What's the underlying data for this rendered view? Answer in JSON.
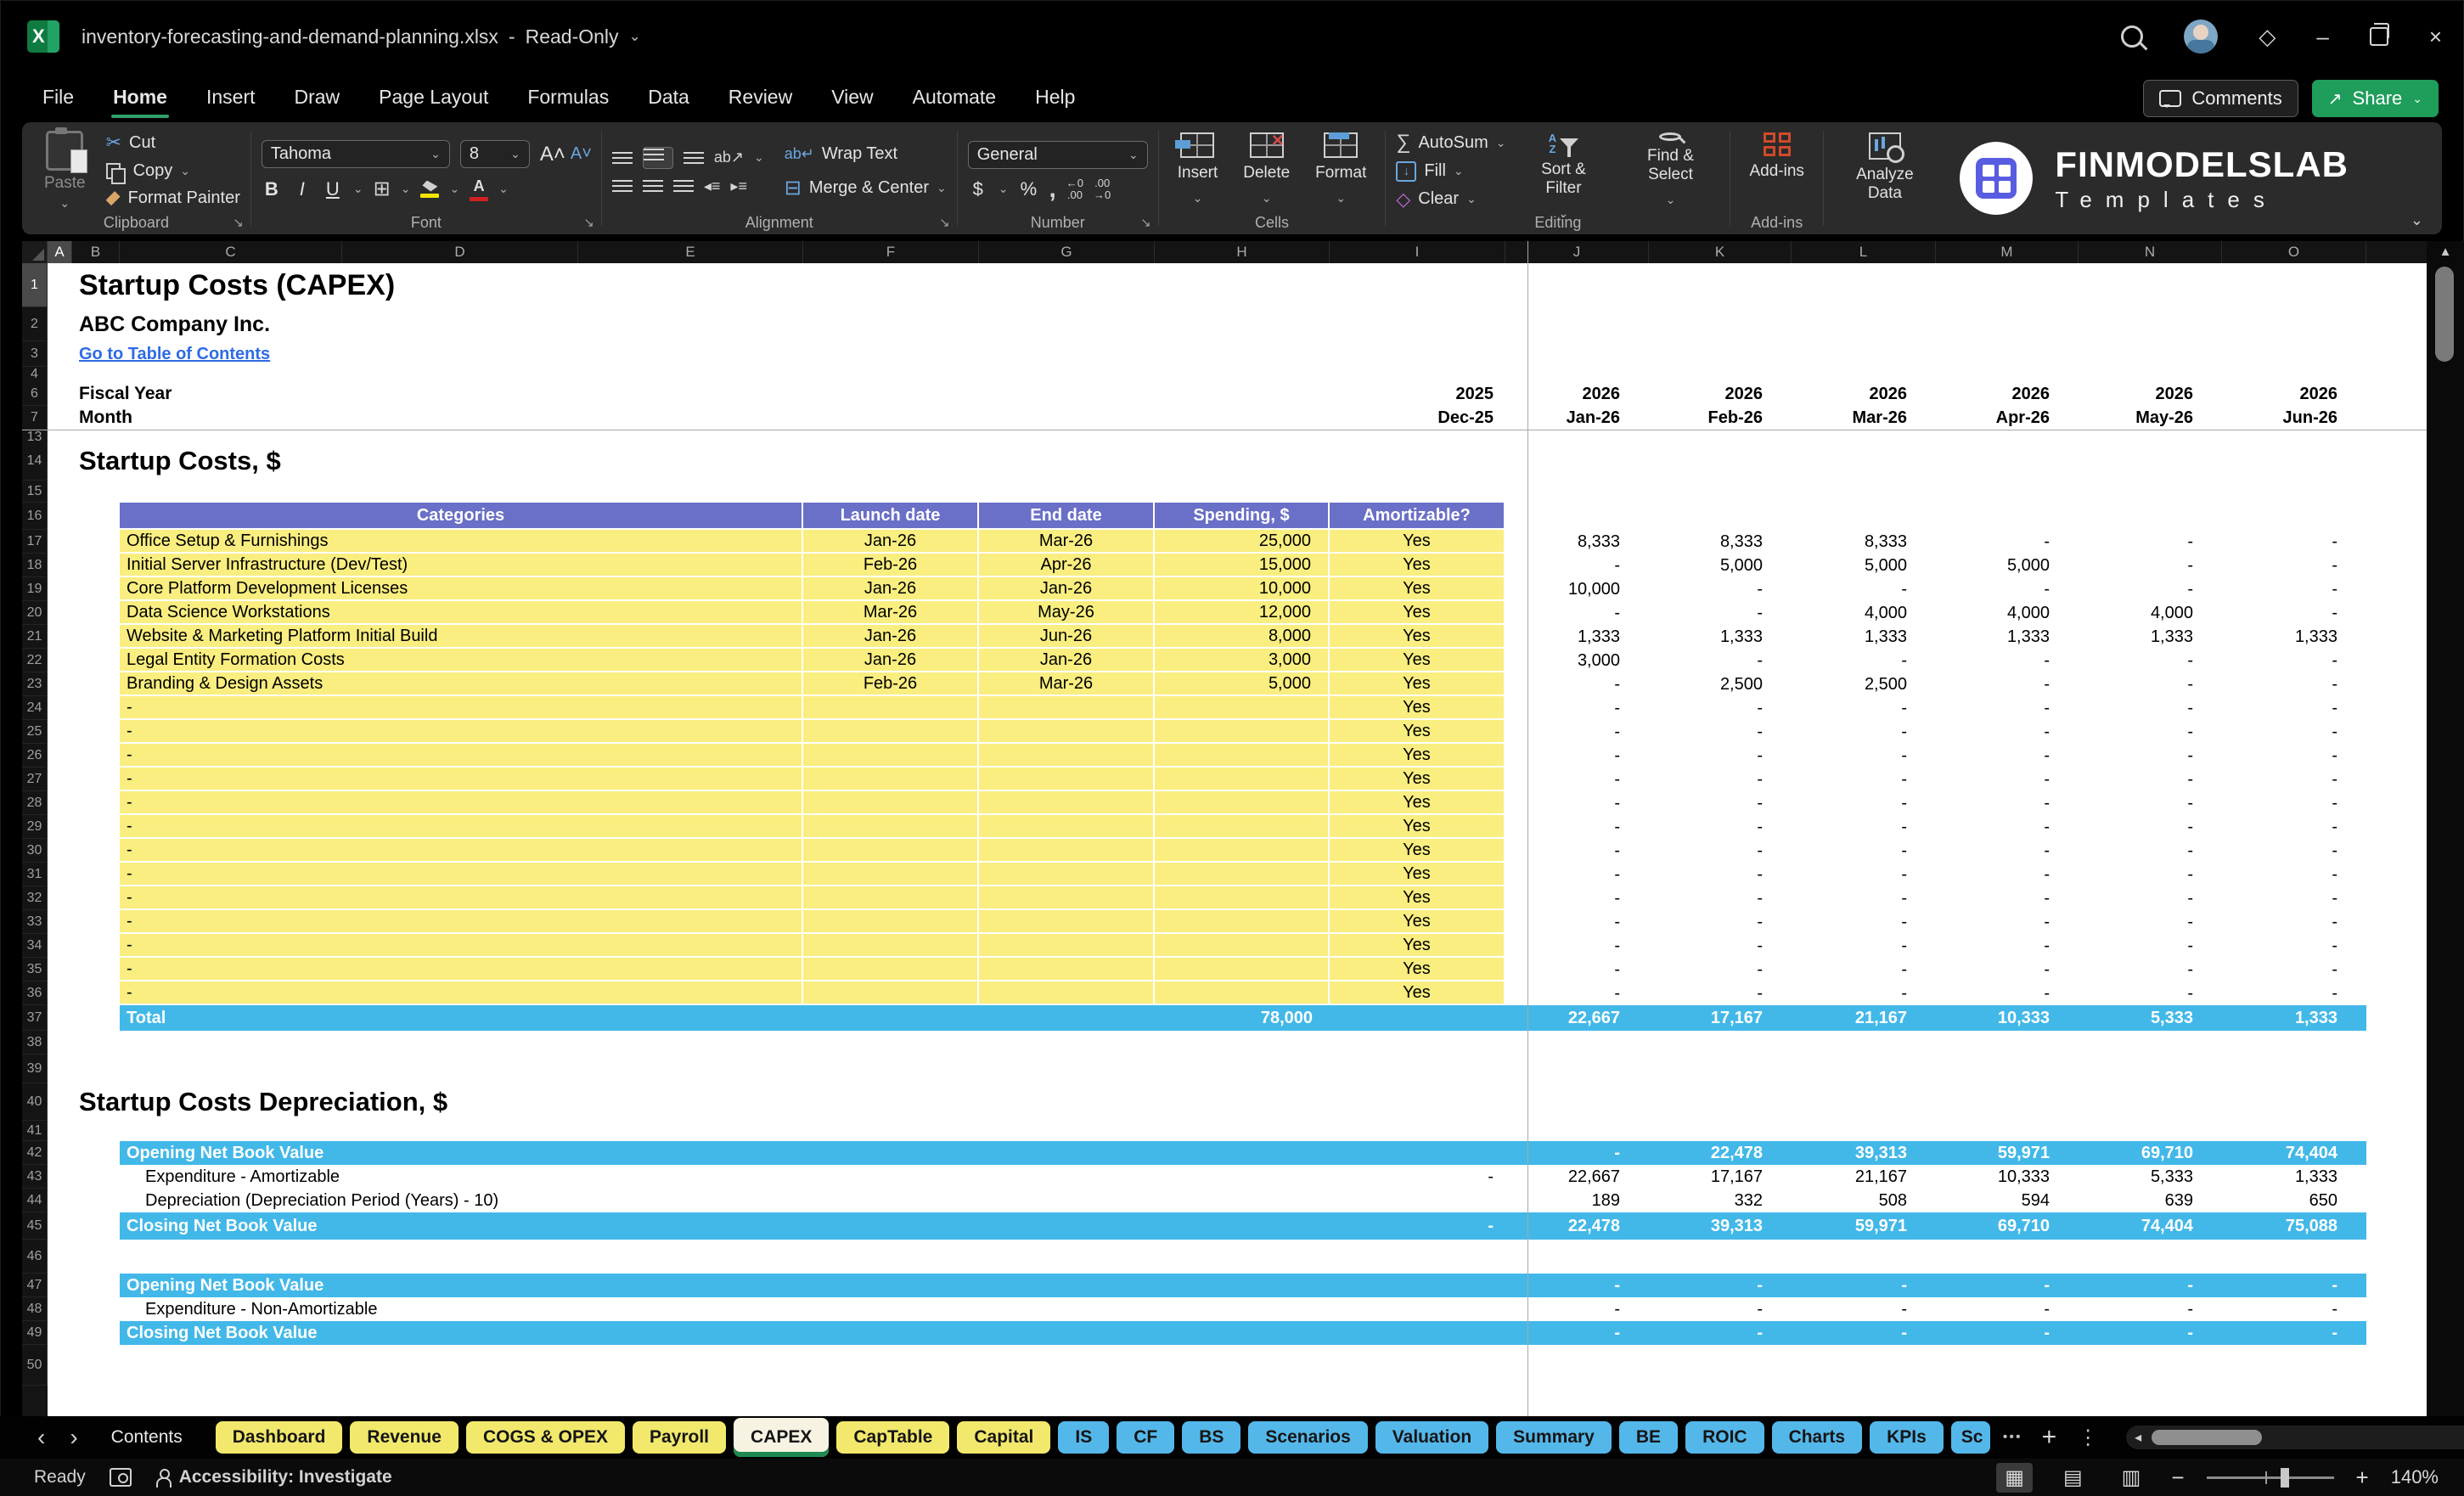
{
  "titlebar": {
    "filename": "inventory-forecasting-and-demand-planning.xlsx",
    "separator": "-",
    "mode": "Read-Only"
  },
  "menubar": {
    "items": [
      "File",
      "Home",
      "Insert",
      "Draw",
      "Page Layout",
      "Formulas",
      "Data",
      "Review",
      "View",
      "Automate",
      "Help"
    ],
    "active": "Home"
  },
  "actions": {
    "comments": "Comments",
    "share": "Share"
  },
  "ribbon": {
    "clipboard": {
      "group_label": "Clipboard",
      "paste": "Paste",
      "cut": "Cut",
      "copy": "Copy",
      "format_painter": "Format Painter"
    },
    "font": {
      "group_label": "Font",
      "font_name": "Tahoma",
      "font_size": "8",
      "bold": "B",
      "italic": "I",
      "underline": "U"
    },
    "alignment": {
      "group_label": "Alignment",
      "wrap_text": "Wrap Text",
      "merge_center": "Merge & Center"
    },
    "number": {
      "group_label": "Number",
      "format": "General",
      "currency": "$",
      "percent": "%"
    },
    "cells": {
      "group_label": "Cells",
      "insert": "Insert",
      "delete": "Delete",
      "format": "Format"
    },
    "editing": {
      "group_label": "Editing",
      "autosum": "AutoSum",
      "fill": "Fill",
      "clear": "Clear",
      "sort_filter": "Sort & Filter",
      "find_select": "Find & Select"
    },
    "addins": {
      "group_label": "Add-ins",
      "addins": "Add-ins",
      "analyze_data": "Analyze Data"
    }
  },
  "brand": {
    "name": "FINMODELSLAB",
    "subtitle": "Templates"
  },
  "colors": {
    "table_header_purple": "#6A6FC7",
    "row_yellow": "#F9EE7F",
    "band_blue": "#42B8E8",
    "link_blue": "#2E6BE5",
    "tab_yellow": "#F2E96C",
    "tab_blue": "#54B7EA",
    "accent_green": "#1F9D5B"
  },
  "sheet": {
    "columns": [
      "A",
      "B",
      "C",
      "D",
      "E",
      "F",
      "G",
      "H",
      "I",
      "J",
      "K",
      "L",
      "M",
      "N",
      "O"
    ],
    "row_numbers": [
      "1",
      "2",
      "3",
      "4",
      "6",
      "7",
      "13",
      "14",
      "15",
      "16",
      "17",
      "18",
      "19",
      "20",
      "21",
      "22",
      "23",
      "24",
      "25",
      "26",
      "27",
      "28",
      "29",
      "30",
      "31",
      "32",
      "33",
      "34",
      "35",
      "36",
      "37",
      "38",
      "39",
      "40",
      "41",
      "42",
      "43",
      "44",
      "45",
      "46",
      "47",
      "48",
      "49",
      "50"
    ],
    "title": "Startup Costs (CAPEX)",
    "company": "ABC Company Inc.",
    "toc_link": "Go to Table of Contents",
    "fiscal_year_label": "Fiscal Year",
    "month_label": "Month",
    "fiscal_years": [
      "2025",
      "2026",
      "2026",
      "2026",
      "2026",
      "2026",
      "2026"
    ],
    "months": [
      "Dec-25",
      "Jan-26",
      "Feb-26",
      "Mar-26",
      "Apr-26",
      "May-26",
      "Jun-26"
    ],
    "section1_title": "Startup Costs, $",
    "table": {
      "headers": {
        "categories": "Categories",
        "launch": "Launch date",
        "end": "End date",
        "spending": "Spending, $",
        "amortizable": "Amortizable?"
      },
      "rows": [
        {
          "category": "Office Setup & Furnishings",
          "launch": "Jan-26",
          "end": "Mar-26",
          "spending": "25,000",
          "amortizable": "Yes",
          "monthly": [
            "8,333",
            "8,333",
            "8,333",
            "-",
            "-",
            "-"
          ]
        },
        {
          "category": "Initial Server Infrastructure (Dev/Test)",
          "launch": "Feb-26",
          "end": "Apr-26",
          "spending": "15,000",
          "amortizable": "Yes",
          "monthly": [
            "-",
            "5,000",
            "5,000",
            "5,000",
            "-",
            "-"
          ]
        },
        {
          "category": "Core Platform Development Licenses",
          "launch": "Jan-26",
          "end": "Jan-26",
          "spending": "10,000",
          "amortizable": "Yes",
          "monthly": [
            "10,000",
            "-",
            "-",
            "-",
            "-",
            "-"
          ]
        },
        {
          "category": "Data Science Workstations",
          "launch": "Mar-26",
          "end": "May-26",
          "spending": "12,000",
          "amortizable": "Yes",
          "monthly": [
            "-",
            "-",
            "4,000",
            "4,000",
            "4,000",
            "-"
          ]
        },
        {
          "category": "Website & Marketing Platform Initial Build",
          "launch": "Jan-26",
          "end": "Jun-26",
          "spending": "8,000",
          "amortizable": "Yes",
          "monthly": [
            "1,333",
            "1,333",
            "1,333",
            "1,333",
            "1,333",
            "1,333"
          ]
        },
        {
          "category": "Legal Entity Formation Costs",
          "launch": "Jan-26",
          "end": "Jan-26",
          "spending": "3,000",
          "amortizable": "Yes",
          "monthly": [
            "3,000",
            "-",
            "-",
            "-",
            "-",
            "-"
          ]
        },
        {
          "category": "Branding & Design Assets",
          "launch": "Feb-26",
          "end": "Mar-26",
          "spending": "5,000",
          "amortizable": "Yes",
          "monthly": [
            "-",
            "2,500",
            "2,500",
            "-",
            "-",
            "-"
          ]
        },
        {
          "category": "-",
          "launch": "",
          "end": "",
          "spending": "",
          "amortizable": "Yes",
          "monthly": [
            "-",
            "-",
            "-",
            "-",
            "-",
            "-"
          ]
        },
        {
          "category": "-",
          "launch": "",
          "end": "",
          "spending": "",
          "amortizable": "Yes",
          "monthly": [
            "-",
            "-",
            "-",
            "-",
            "-",
            "-"
          ]
        },
        {
          "category": "-",
          "launch": "",
          "end": "",
          "spending": "",
          "amortizable": "Yes",
          "monthly": [
            "-",
            "-",
            "-",
            "-",
            "-",
            "-"
          ]
        },
        {
          "category": "-",
          "launch": "",
          "end": "",
          "spending": "",
          "amortizable": "Yes",
          "monthly": [
            "-",
            "-",
            "-",
            "-",
            "-",
            "-"
          ]
        },
        {
          "category": "-",
          "launch": "",
          "end": "",
          "spending": "",
          "amortizable": "Yes",
          "monthly": [
            "-",
            "-",
            "-",
            "-",
            "-",
            "-"
          ]
        },
        {
          "category": "-",
          "launch": "",
          "end": "",
          "spending": "",
          "amortizable": "Yes",
          "monthly": [
            "-",
            "-",
            "-",
            "-",
            "-",
            "-"
          ]
        },
        {
          "category": "-",
          "launch": "",
          "end": "",
          "spending": "",
          "amortizable": "Yes",
          "monthly": [
            "-",
            "-",
            "-",
            "-",
            "-",
            "-"
          ]
        },
        {
          "category": "-",
          "launch": "",
          "end": "",
          "spending": "",
          "amortizable": "Yes",
          "monthly": [
            "-",
            "-",
            "-",
            "-",
            "-",
            "-"
          ]
        },
        {
          "category": "-",
          "launch": "",
          "end": "",
          "spending": "",
          "amortizable": "Yes",
          "monthly": [
            "-",
            "-",
            "-",
            "-",
            "-",
            "-"
          ]
        },
        {
          "category": "-",
          "launch": "",
          "end": "",
          "spending": "",
          "amortizable": "Yes",
          "monthly": [
            "-",
            "-",
            "-",
            "-",
            "-",
            "-"
          ]
        },
        {
          "category": "-",
          "launch": "",
          "end": "",
          "spending": "",
          "amortizable": "Yes",
          "monthly": [
            "-",
            "-",
            "-",
            "-",
            "-",
            "-"
          ]
        },
        {
          "category": "-",
          "launch": "",
          "end": "",
          "spending": "",
          "amortizable": "Yes",
          "monthly": [
            "-",
            "-",
            "-",
            "-",
            "-",
            "-"
          ]
        },
        {
          "category": "-",
          "launch": "",
          "end": "",
          "spending": "",
          "amortizable": "Yes",
          "monthly": [
            "-",
            "-",
            "-",
            "-",
            "-",
            "-"
          ]
        }
      ],
      "total_label": "Total",
      "total_spending": "78,000",
      "total_monthly": [
        "22,667",
        "17,167",
        "21,167",
        "10,333",
        "5,333",
        "1,333"
      ]
    },
    "section2_title": "Startup Costs Depreciation, $",
    "depreciation_rows": [
      {
        "label": "Opening Net Book Value",
        "style": "blue",
        "dec25": "",
        "monthly": [
          "-",
          "22,478",
          "39,313",
          "59,971",
          "69,710",
          "74,404"
        ]
      },
      {
        "label": "Expenditure - Amortizable",
        "style": "plain",
        "dec25": "-",
        "monthly": [
          "22,667",
          "17,167",
          "21,167",
          "10,333",
          "5,333",
          "1,333"
        ]
      },
      {
        "label": "Depreciation (Depreciation Period (Years) - 10)",
        "style": "plain",
        "dec25": "",
        "monthly": [
          "189",
          "332",
          "508",
          "594",
          "639",
          "650"
        ]
      },
      {
        "label": "Closing Net Book Value",
        "style": "blue",
        "dec25": "-",
        "monthly": [
          "22,478",
          "39,313",
          "59,971",
          "69,710",
          "74,404",
          "75,088"
        ]
      }
    ],
    "non_amortizable_rows": [
      {
        "label": "Opening Net Book Value",
        "style": "blue",
        "dec25": "",
        "monthly": [
          "-",
          "-",
          "-",
          "-",
          "-",
          "-"
        ]
      },
      {
        "label": "Expenditure - Non-Amortizable",
        "style": "plain",
        "dec25": "",
        "monthly": [
          "-",
          "-",
          "-",
          "-",
          "-",
          "-"
        ]
      },
      {
        "label": "Closing Net Book Value",
        "style": "blue",
        "dec25": "",
        "monthly": [
          "-",
          "-",
          "-",
          "-",
          "-",
          "-"
        ]
      }
    ]
  },
  "tabs": {
    "items": [
      {
        "label": "Contents",
        "kind": "plain"
      },
      {
        "label": "Dashboard",
        "kind": "yellow"
      },
      {
        "label": "Revenue",
        "kind": "yellow"
      },
      {
        "label": "COGS & OPEX",
        "kind": "yellow"
      },
      {
        "label": "Payroll",
        "kind": "yellow"
      },
      {
        "label": "CAPEX",
        "kind": "active"
      },
      {
        "label": "CapTable",
        "kind": "yellow"
      },
      {
        "label": "Capital",
        "kind": "yellow"
      },
      {
        "label": "IS",
        "kind": "blue"
      },
      {
        "label": "CF",
        "kind": "blue"
      },
      {
        "label": "BS",
        "kind": "blue"
      },
      {
        "label": "Scenarios",
        "kind": "blue"
      },
      {
        "label": "Valuation",
        "kind": "blue"
      },
      {
        "label": "Summary",
        "kind": "blue"
      },
      {
        "label": "BE",
        "kind": "blue"
      },
      {
        "label": "ROIC",
        "kind": "blue"
      },
      {
        "label": "Charts",
        "kind": "blue"
      },
      {
        "label": "KPIs",
        "kind": "blue"
      },
      {
        "label": "Sc",
        "kind": "blue cut"
      }
    ]
  },
  "statusbar": {
    "ready": "Ready",
    "accessibility": "Accessibility: Investigate",
    "zoom_level": "140%"
  }
}
